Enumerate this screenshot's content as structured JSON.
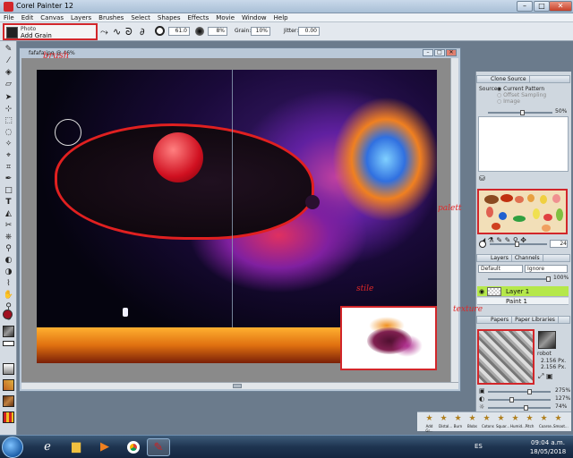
{
  "window": {
    "title": "Corel Painter 12",
    "buttons": {
      "minimize": "–",
      "maximize": "□",
      "close": "✕"
    }
  },
  "menu": [
    "File",
    "Edit",
    "Canvas",
    "Layers",
    "Brushes",
    "Select",
    "Shapes",
    "Effects",
    "Movie",
    "Window",
    "Help"
  ],
  "property_bar": {
    "brush_category": "Photo",
    "brush_variant": "Add Grain",
    "size_value": "61.0",
    "opacity_value": "8%",
    "grain_label": "Grain:",
    "grain_value": "10%",
    "jitter_label": "Jitter:",
    "jitter_value": "0.00"
  },
  "document": {
    "title": "fafafa.jpg @ 46%"
  },
  "annotations": {
    "brush_label": "brush",
    "palette_label": "palett",
    "style_label": "stile",
    "texture_label": "texture"
  },
  "panels": {
    "clone_source": {
      "title": "Clone Source",
      "source_label": "Source:",
      "options": [
        "Current Pattern",
        "Offset Sampling",
        "Image"
      ],
      "opacity_value": "50%"
    },
    "layers": {
      "tabs": [
        "Layers",
        "Channels"
      ],
      "composite_method": "Default",
      "preserve": "Ignore",
      "opacity_value": "100%",
      "items": [
        "Layer 1",
        "Paint 1"
      ]
    },
    "papers": {
      "tabs": [
        "Papers",
        "Paper Libraries"
      ],
      "paper_name": "robot",
      "scale_a": "2.156 Px.",
      "scale_b": "2.156 Px.",
      "scale_value": "275%",
      "contrast_value": "127%",
      "brightness_value": "74%"
    },
    "color": {
      "size_value": "24"
    }
  },
  "dock": [
    "Add Gr...",
    "Distal...",
    "Burn",
    "Blobs",
    "Cotons",
    "Squar...",
    "Humid...",
    "Pitch",
    "Coarse...",
    "Smoot..."
  ],
  "taskbar": {
    "language": "ES",
    "time": "09:04 a.m.",
    "date": "18/05/2018"
  },
  "colors": {
    "annotation_red": "#d2262a",
    "layer_selected": "#b5e84a",
    "palette_bg": "#f2dfb8"
  }
}
